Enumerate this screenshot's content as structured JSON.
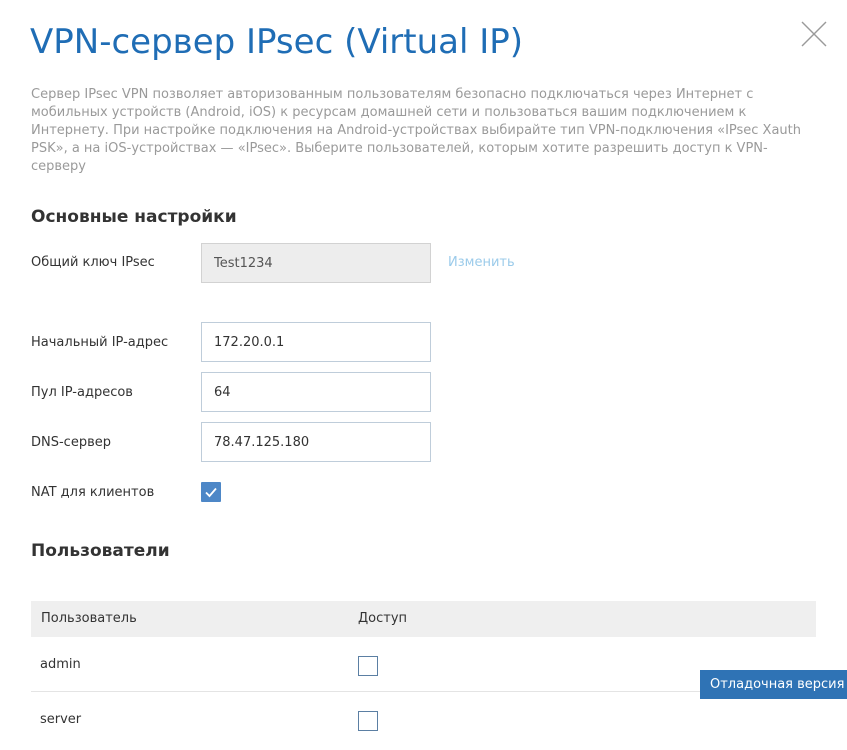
{
  "dialog": {
    "title": "VPN-сервер IPsec (Virtual IP)",
    "description": "Сервер IPsec VPN позволяет авторизованным пользователям безопасно подключаться через Интернет с мобильных устройств (Android, iOS) к ресурсам домашней сети и пользоваться вашим подключением к Интернету. При настройке подключения на Android-устройствах выбирайте тип VPN-подключения «IPsec Xauth PSK», а на iOS-устройствах — «IPsec». Выберите пользователей, которым хотите разрешить доступ к VPN-серверу",
    "close_icon": "close-icon"
  },
  "basic": {
    "title": "Основные настройки",
    "psk_label": "Общий ключ IPsec",
    "psk_value": "Test1234",
    "change_label": "Изменить",
    "start_ip_label": "Начальный IP-адрес",
    "start_ip_value": "172.20.0.1",
    "pool_label": "Пул IP-адресов",
    "pool_value": "64",
    "dns_label": "DNS-сервер",
    "dns_value": "78.47.125.180",
    "nat_label": "NAT для клиентов",
    "nat_checked": true
  },
  "users": {
    "title": "Пользователи",
    "columns": {
      "user": "Пользователь",
      "access": "Доступ"
    },
    "rows": [
      {
        "name": "admin",
        "access": false
      },
      {
        "name": "server",
        "access": false
      }
    ]
  },
  "debug_badge": "Отладочная версия",
  "colors": {
    "accent": "#1f6db5",
    "link": "#9bcbea",
    "checkbox": "#4d87c7",
    "badge": "#2f73b5"
  }
}
